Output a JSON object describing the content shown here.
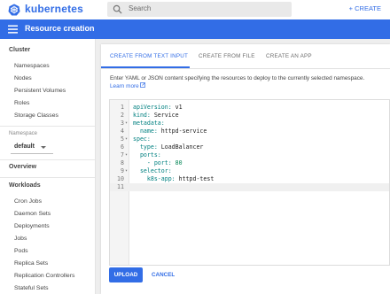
{
  "topbar": {
    "brand": "kubernetes",
    "search_placeholder": "Search",
    "create_label": "+ CREATE"
  },
  "header": {
    "title": "Resource creation"
  },
  "sidebar": {
    "cluster_title": "Cluster",
    "cluster_items": [
      "Namespaces",
      "Nodes",
      "Persistent Volumes",
      "Roles",
      "Storage Classes"
    ],
    "namespace_label": "Namespace",
    "namespace_value": "default",
    "overview": "Overview",
    "workloads_title": "Workloads",
    "workload_items": [
      "Cron Jobs",
      "Daemon Sets",
      "Deployments",
      "Jobs",
      "Pods",
      "Replica Sets",
      "Replication Controllers",
      "Stateful Sets"
    ]
  },
  "tabs": [
    "CREATE FROM TEXT INPUT",
    "CREATE FROM FILE",
    "CREATE AN APP"
  ],
  "description": "Enter YAML or JSON content specifying the resources to deploy to the currently selected namespace.",
  "learn_more": "Learn more",
  "editor": {
    "lines": [
      {
        "n": "1",
        "fold": "",
        "key": "apiVersion:",
        "val": " v1"
      },
      {
        "n": "2",
        "fold": "",
        "key": "kind:",
        "val": " Service"
      },
      {
        "n": "3",
        "fold": "▾",
        "key": "metadata:",
        "val": ""
      },
      {
        "n": "4",
        "fold": "",
        "key": "  name:",
        "val": " httpd-service"
      },
      {
        "n": "5",
        "fold": "▾",
        "key": "spec:",
        "val": ""
      },
      {
        "n": "6",
        "fold": "",
        "key": "  type:",
        "val": " LoadBalancer"
      },
      {
        "n": "7",
        "fold": "▾",
        "key": "  ports:",
        "val": ""
      },
      {
        "n": "8",
        "fold": "",
        "key": "    - port:",
        "val": " 80"
      },
      {
        "n": "9",
        "fold": "▾",
        "key": "  selector:",
        "val": ""
      },
      {
        "n": "10",
        "fold": "",
        "key": "    k8s-app:",
        "val": " httpd-test"
      },
      {
        "n": "11",
        "fold": "",
        "key": "",
        "val": ""
      }
    ]
  },
  "buttons": {
    "upload": "UPLOAD",
    "cancel": "CANCEL"
  },
  "colors": {
    "brand": "#326de6"
  }
}
